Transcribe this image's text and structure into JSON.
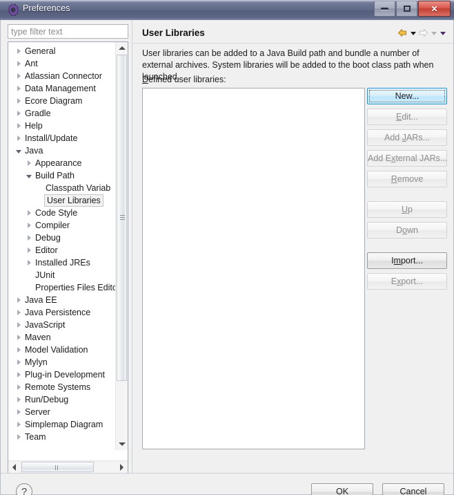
{
  "window": {
    "title": "Preferences",
    "icon": "gear-icon",
    "buttons": {
      "minimize": "minimize-icon",
      "maximize": "maximize-icon",
      "close": "✕"
    }
  },
  "filter": {
    "placeholder": "type filter text",
    "value": ""
  },
  "tree": {
    "items": [
      {
        "label": "General",
        "indent": 0,
        "state": "collapsed"
      },
      {
        "label": "Ant",
        "indent": 0,
        "state": "collapsed"
      },
      {
        "label": "Atlassian Connector",
        "indent": 0,
        "state": "collapsed"
      },
      {
        "label": "Data Management",
        "indent": 0,
        "state": "collapsed"
      },
      {
        "label": "Ecore Diagram",
        "indent": 0,
        "state": "collapsed"
      },
      {
        "label": "Gradle",
        "indent": 0,
        "state": "collapsed"
      },
      {
        "label": "Help",
        "indent": 0,
        "state": "collapsed"
      },
      {
        "label": "Install/Update",
        "indent": 0,
        "state": "collapsed"
      },
      {
        "label": "Java",
        "indent": 0,
        "state": "expanded"
      },
      {
        "label": "Appearance",
        "indent": 1,
        "state": "collapsed"
      },
      {
        "label": "Build Path",
        "indent": 1,
        "state": "expanded"
      },
      {
        "label": "Classpath Variab",
        "indent": 2,
        "state": "leaf"
      },
      {
        "label": "User Libraries",
        "indent": 2,
        "state": "leaf",
        "selected": true
      },
      {
        "label": "Code Style",
        "indent": 1,
        "state": "collapsed"
      },
      {
        "label": "Compiler",
        "indent": 1,
        "state": "collapsed"
      },
      {
        "label": "Debug",
        "indent": 1,
        "state": "collapsed"
      },
      {
        "label": "Editor",
        "indent": 1,
        "state": "collapsed"
      },
      {
        "label": "Installed JREs",
        "indent": 1,
        "state": "collapsed"
      },
      {
        "label": "JUnit",
        "indent": 1,
        "state": "leaf"
      },
      {
        "label": "Properties Files Edito",
        "indent": 1,
        "state": "leaf"
      },
      {
        "label": "Java EE",
        "indent": 0,
        "state": "collapsed"
      },
      {
        "label": "Java Persistence",
        "indent": 0,
        "state": "collapsed"
      },
      {
        "label": "JavaScript",
        "indent": 0,
        "state": "collapsed"
      },
      {
        "label": "Maven",
        "indent": 0,
        "state": "collapsed"
      },
      {
        "label": "Model Validation",
        "indent": 0,
        "state": "collapsed"
      },
      {
        "label": "Mylyn",
        "indent": 0,
        "state": "collapsed"
      },
      {
        "label": "Plug-in Development",
        "indent": 0,
        "state": "collapsed"
      },
      {
        "label": "Remote Systems",
        "indent": 0,
        "state": "collapsed"
      },
      {
        "label": "Run/Debug",
        "indent": 0,
        "state": "collapsed"
      },
      {
        "label": "Server",
        "indent": 0,
        "state": "collapsed"
      },
      {
        "label": "Simplemap Diagram",
        "indent": 0,
        "state": "collapsed"
      },
      {
        "label": "Team",
        "indent": 0,
        "state": "collapsed"
      }
    ]
  },
  "page": {
    "title": "User Libraries",
    "description": "User libraries can be added to a Java Build path and bundle a number of external archives. System libraries will be added to the boot class path when launched.",
    "list_label_mnemonic": "D",
    "list_label_rest": "efined user libraries:",
    "nav": {
      "back": "back-arrow",
      "back_menu": "back-dropdown",
      "forward": "forward-arrow",
      "forward_menu": "forward-dropdown",
      "view_menu": "view-menu-dropdown",
      "back_color": "#d9a52a",
      "forward_color": "#c9c9c9"
    },
    "list_items": []
  },
  "buttons": [
    {
      "mnemonic": "",
      "pre": "",
      "post": "New...",
      "state": "focused"
    },
    {
      "mnemonic": "E",
      "pre": "",
      "post": "dit...",
      "state": "disabled"
    },
    {
      "mnemonic": "J",
      "pre": "Add ",
      "post": "ARs...",
      "state": "disabled"
    },
    {
      "mnemonic": "x",
      "pre": "Add E",
      "post": "ternal JARs...",
      "state": "disabled"
    },
    {
      "mnemonic": "R",
      "pre": "",
      "post": "emove",
      "state": "disabled"
    },
    {
      "mnemonic": "U",
      "pre": "",
      "post": "p",
      "state": "disabled",
      "gap_before": true
    },
    {
      "mnemonic": "o",
      "pre": "D",
      "post": "wn",
      "state": "disabled"
    },
    {
      "mnemonic": "m",
      "pre": "I",
      "post": "port...",
      "state": "enabled",
      "gap_before": true
    },
    {
      "mnemonic": "x",
      "pre": "E",
      "post": "port...",
      "state": "disabled"
    }
  ],
  "footer": {
    "help": "?",
    "ok": "OK",
    "cancel": "Cancel"
  }
}
